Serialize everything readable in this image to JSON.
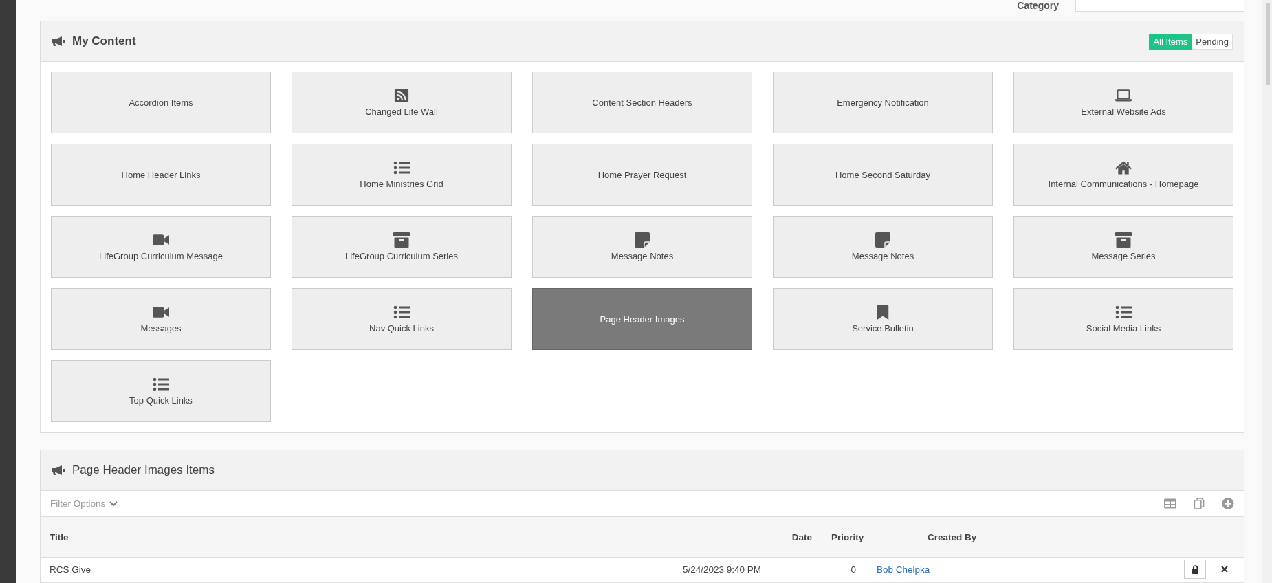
{
  "category_filter": {
    "label": "Category"
  },
  "content_panel": {
    "title": "My Content",
    "toggle": [
      {
        "label": "All Items",
        "selected": true
      },
      {
        "label": "Pending",
        "selected": false
      }
    ],
    "tiles": [
      {
        "label": "Accordion Items",
        "kind": "none",
        "selected": false
      },
      {
        "label": "Changed Life Wall",
        "kind": "rss",
        "selected": false
      },
      {
        "label": "Content Section Headers",
        "kind": "none",
        "selected": false
      },
      {
        "label": "Emergency Notification",
        "kind": "none",
        "selected": false
      },
      {
        "label": "External Website Ads",
        "kind": "laptop",
        "selected": false
      },
      {
        "label": "Home Header Links",
        "kind": "none",
        "selected": false
      },
      {
        "label": "Home Ministries Grid",
        "kind": "list",
        "selected": false
      },
      {
        "label": "Home Prayer Request",
        "kind": "none",
        "selected": false
      },
      {
        "label": "Home Second Saturday",
        "kind": "none",
        "selected": false
      },
      {
        "label": "Internal Communications - Homepage",
        "kind": "home",
        "selected": false
      },
      {
        "label": "LifeGroup Curriculum Message",
        "kind": "video",
        "selected": false
      },
      {
        "label": "LifeGroup Curriculum Series",
        "kind": "archive",
        "selected": false
      },
      {
        "label": "Message Notes",
        "kind": "note",
        "selected": false
      },
      {
        "label": "Message Notes",
        "kind": "note",
        "selected": false
      },
      {
        "label": "Message Series",
        "kind": "archive",
        "selected": false
      },
      {
        "label": "Messages",
        "kind": "video",
        "selected": false
      },
      {
        "label": "Nav Quick Links",
        "kind": "list",
        "selected": false
      },
      {
        "label": "Page Header Images",
        "kind": "none",
        "selected": true
      },
      {
        "label": "Service Bulletin",
        "kind": "bookmark",
        "selected": false
      },
      {
        "label": "Social Media Links",
        "kind": "list",
        "selected": false
      },
      {
        "label": "Top Quick Links",
        "kind": "list",
        "selected": false
      }
    ]
  },
  "items_panel": {
    "title": "Page Header Images Items",
    "filter_label": "Filter Options",
    "table": {
      "columns": [
        "Title",
        "Date",
        "Priority",
        "Created By"
      ],
      "rows": [
        {
          "title": "RCS Give",
          "date": "5/24/2023 9:40 PM",
          "priority": "0",
          "created_by": "Bob Chelpka"
        }
      ]
    }
  }
}
